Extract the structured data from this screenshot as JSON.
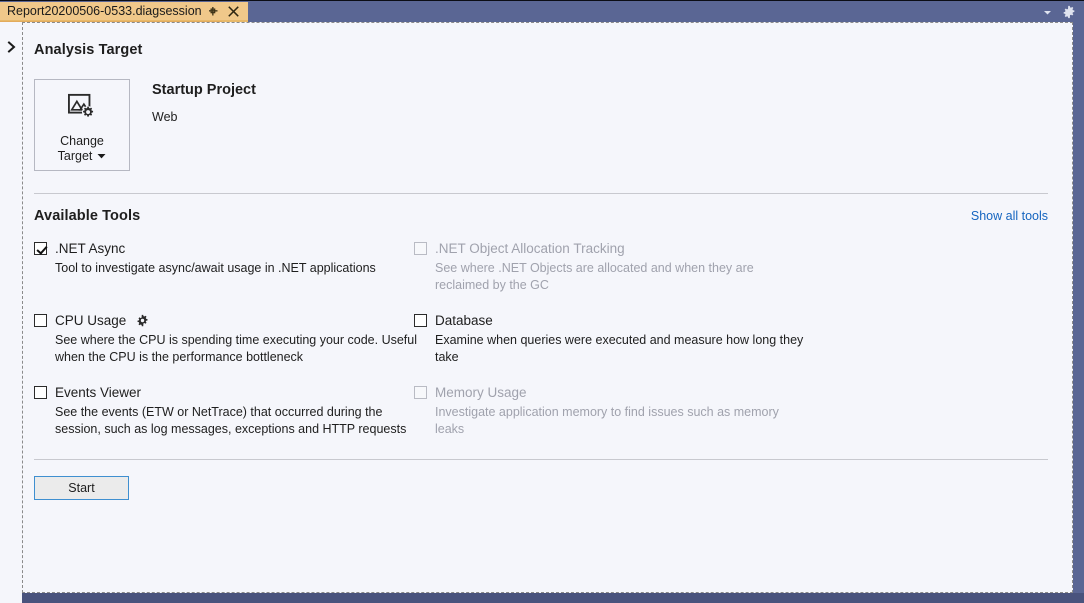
{
  "window": {
    "tab": {
      "title": "Report20200506-0533.diagsession",
      "pin_icon": "pin-icon",
      "close_icon": "close-icon"
    },
    "controls": {
      "chevron_icon": "chevron-down-icon",
      "settings_icon": "gear-icon"
    },
    "expander_icon": "chevron-right-icon"
  },
  "analysis_target": {
    "heading": "Analysis Target",
    "change_target": {
      "line1": "Change",
      "line2": "Target",
      "dropdown_glyph": "▾",
      "icon": "image-settings-icon"
    },
    "project_name": "Startup Project",
    "project_type": "Web"
  },
  "available_tools": {
    "heading": "Available Tools",
    "show_all_label": "Show all tools",
    "tools": [
      {
        "name": ".NET Async",
        "description": "Tool to investigate async/await usage in .NET applications",
        "checked": true,
        "enabled": true,
        "has_settings": false
      },
      {
        "name": ".NET Object Allocation Tracking",
        "description": "See where .NET Objects are allocated and when they are reclaimed by the GC",
        "checked": false,
        "enabled": false,
        "has_settings": false
      },
      {
        "name": "CPU Usage",
        "description": "See where the CPU is spending time executing your code. Useful when the CPU is the performance bottleneck",
        "checked": false,
        "enabled": true,
        "has_settings": true
      },
      {
        "name": "Database",
        "description": "Examine when queries were executed and measure how long they take",
        "checked": false,
        "enabled": true,
        "has_settings": false
      },
      {
        "name": "Events Viewer",
        "description": "See the events (ETW or NetTrace) that occurred during the session, such as log messages, exceptions and HTTP requests",
        "checked": false,
        "enabled": true,
        "has_settings": false
      },
      {
        "name": "Memory Usage",
        "description": "Investigate application memory to find issues such as memory leaks",
        "checked": false,
        "enabled": false,
        "has_settings": false
      }
    ]
  },
  "actions": {
    "start_label": "Start"
  },
  "colors": {
    "tabbar": "#5a6694",
    "active_tab": "#f0c88a",
    "background": "#f5f6fb",
    "link": "#1565c0",
    "focus_border": "#3f8fd0"
  }
}
